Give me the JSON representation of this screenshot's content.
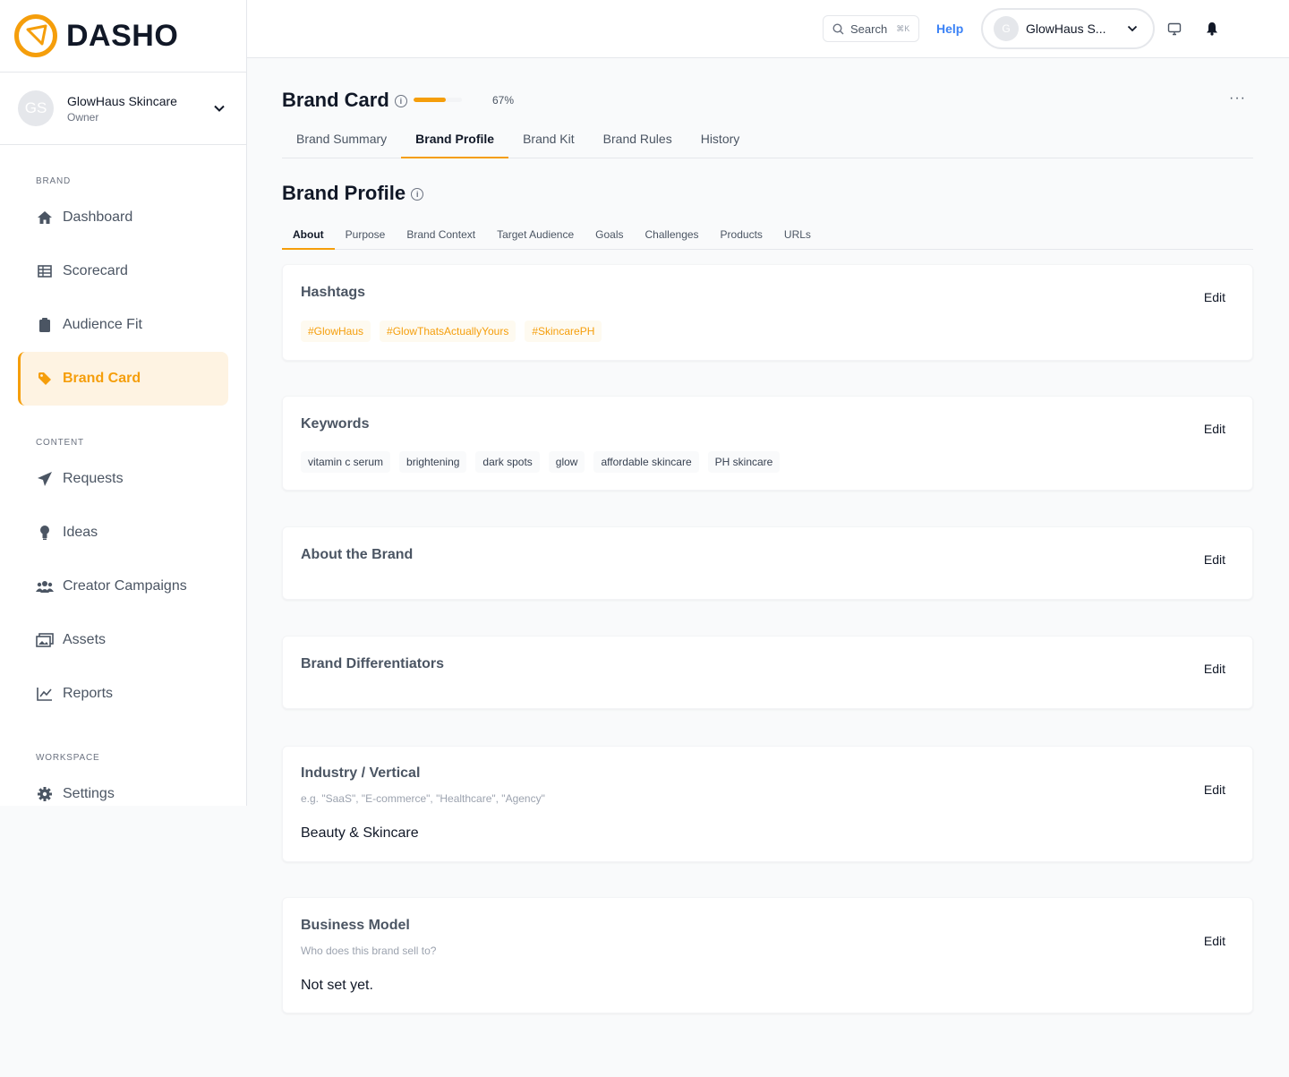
{
  "brand": {
    "name": "DASHO",
    "accent": "#f59e0b"
  },
  "account": {
    "initials": "GS",
    "name": "GlowHaus Skincare",
    "role": "Owner"
  },
  "sidebar": {
    "sections": {
      "brand": "BRAND",
      "content": "CONTENT",
      "workspace": "WORKSPACE"
    },
    "items": [
      {
        "label": "Dashboard",
        "icon": "home-icon"
      },
      {
        "label": "Scorecard",
        "icon": "table-icon"
      },
      {
        "label": "Audience Fit",
        "icon": "clipboard-icon"
      },
      {
        "label": "Brand Card",
        "icon": "tag-icon",
        "active": true
      },
      {
        "label": "Requests",
        "icon": "paper-plane-icon"
      },
      {
        "label": "Ideas",
        "icon": "lightbulb-icon"
      },
      {
        "label": "Creator Campaigns",
        "icon": "users-icon"
      },
      {
        "label": "Assets",
        "icon": "images-icon"
      },
      {
        "label": "Reports",
        "icon": "line-chart-icon"
      },
      {
        "label": "Settings",
        "icon": "gear-icon"
      }
    ]
  },
  "topbar": {
    "search_label": "Search",
    "search_shortcut": "⌘K",
    "help": "Help",
    "user_initial": "G",
    "user_name": "GlowHaus S..."
  },
  "page": {
    "title": "Brand Card",
    "progress_percent": 67,
    "progress_label": "67%",
    "more": "···",
    "tabs": [
      "Brand Summary",
      "Brand Profile",
      "Brand Kit",
      "Brand Rules",
      "History"
    ],
    "active_tab": "Brand Profile"
  },
  "profile": {
    "title": "Brand Profile",
    "subtabs": [
      "About",
      "Purpose",
      "Brand Context",
      "Target Audience",
      "Goals",
      "Challenges",
      "Products",
      "URLs"
    ],
    "active_subtab": "About",
    "edit_label": "Edit",
    "hashtags": {
      "title": "Hashtags",
      "items": [
        "#GlowHaus",
        "#GlowThatsActuallyYours",
        "#SkincarePH"
      ]
    },
    "keywords": {
      "title": "Keywords",
      "items": [
        "vitamin c serum",
        "brightening",
        "dark spots",
        "glow",
        "affordable skincare",
        "PH skincare"
      ]
    },
    "about": {
      "title": "About the Brand"
    },
    "differentiators": {
      "title": "Brand Differentiators"
    },
    "industry": {
      "title": "Industry / Vertical",
      "hint": "e.g. \"SaaS\", \"E-commerce\", \"Healthcare\", \"Agency\"",
      "value": "Beauty & Skincare"
    },
    "business_model": {
      "title": "Business Model",
      "hint": "Who does this brand sell to?",
      "value": "Not set yet."
    }
  }
}
